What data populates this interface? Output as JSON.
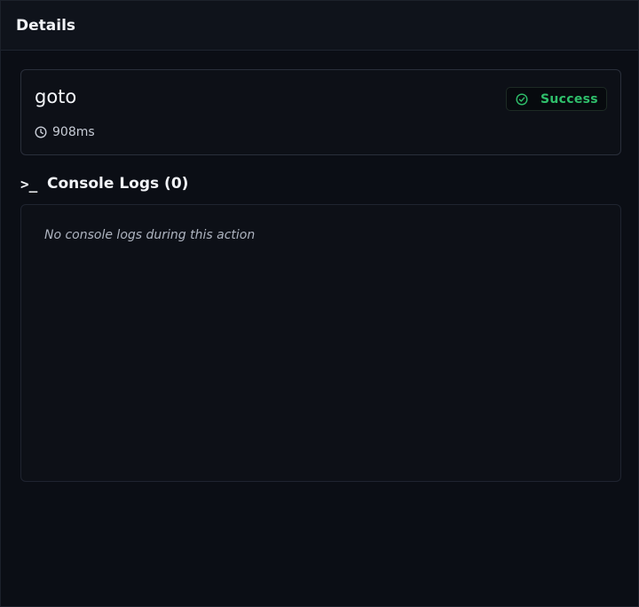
{
  "panel": {
    "title": "Details"
  },
  "action": {
    "name": "goto",
    "duration": "908ms",
    "status": "Success",
    "status_icon": "check-circle-icon",
    "duration_icon": "clock-icon"
  },
  "console": {
    "icon": "terminal-icon",
    "icon_glyph": ">_",
    "title": "Console Logs (0)",
    "empty_message": "No console logs during this action"
  },
  "colors": {
    "success": "#2fbf6b",
    "background": "#0b0e15"
  }
}
